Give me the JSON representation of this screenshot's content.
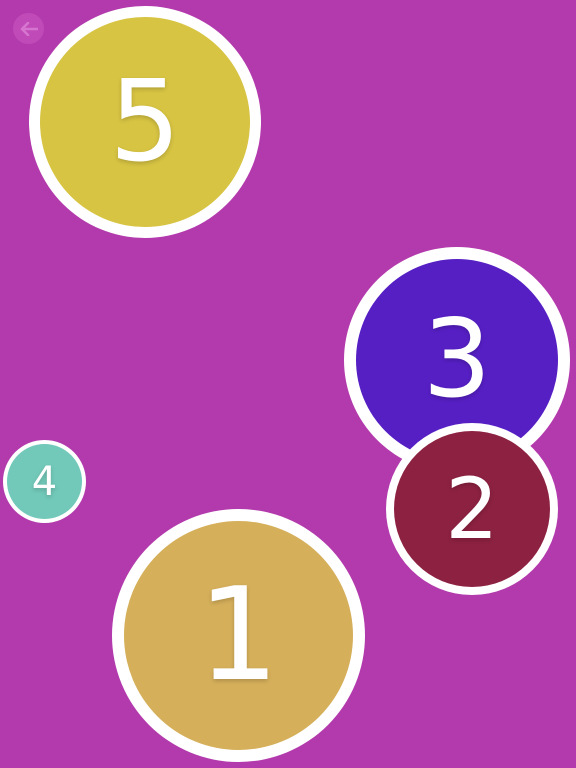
{
  "background_color": "#b33aac",
  "back_button": {
    "icon": "arrow-left-icon",
    "color": "#c04ab8",
    "arrow_color": "#d675cf"
  },
  "bubbles": [
    {
      "number": "5",
      "color": "#d7c443"
    },
    {
      "number": "3",
      "color": "#561fc4"
    },
    {
      "number": "2",
      "color": "#8d2141"
    },
    {
      "number": "4",
      "color": "#72c9b9"
    },
    {
      "number": "1",
      "color": "#d5af5a"
    }
  ]
}
